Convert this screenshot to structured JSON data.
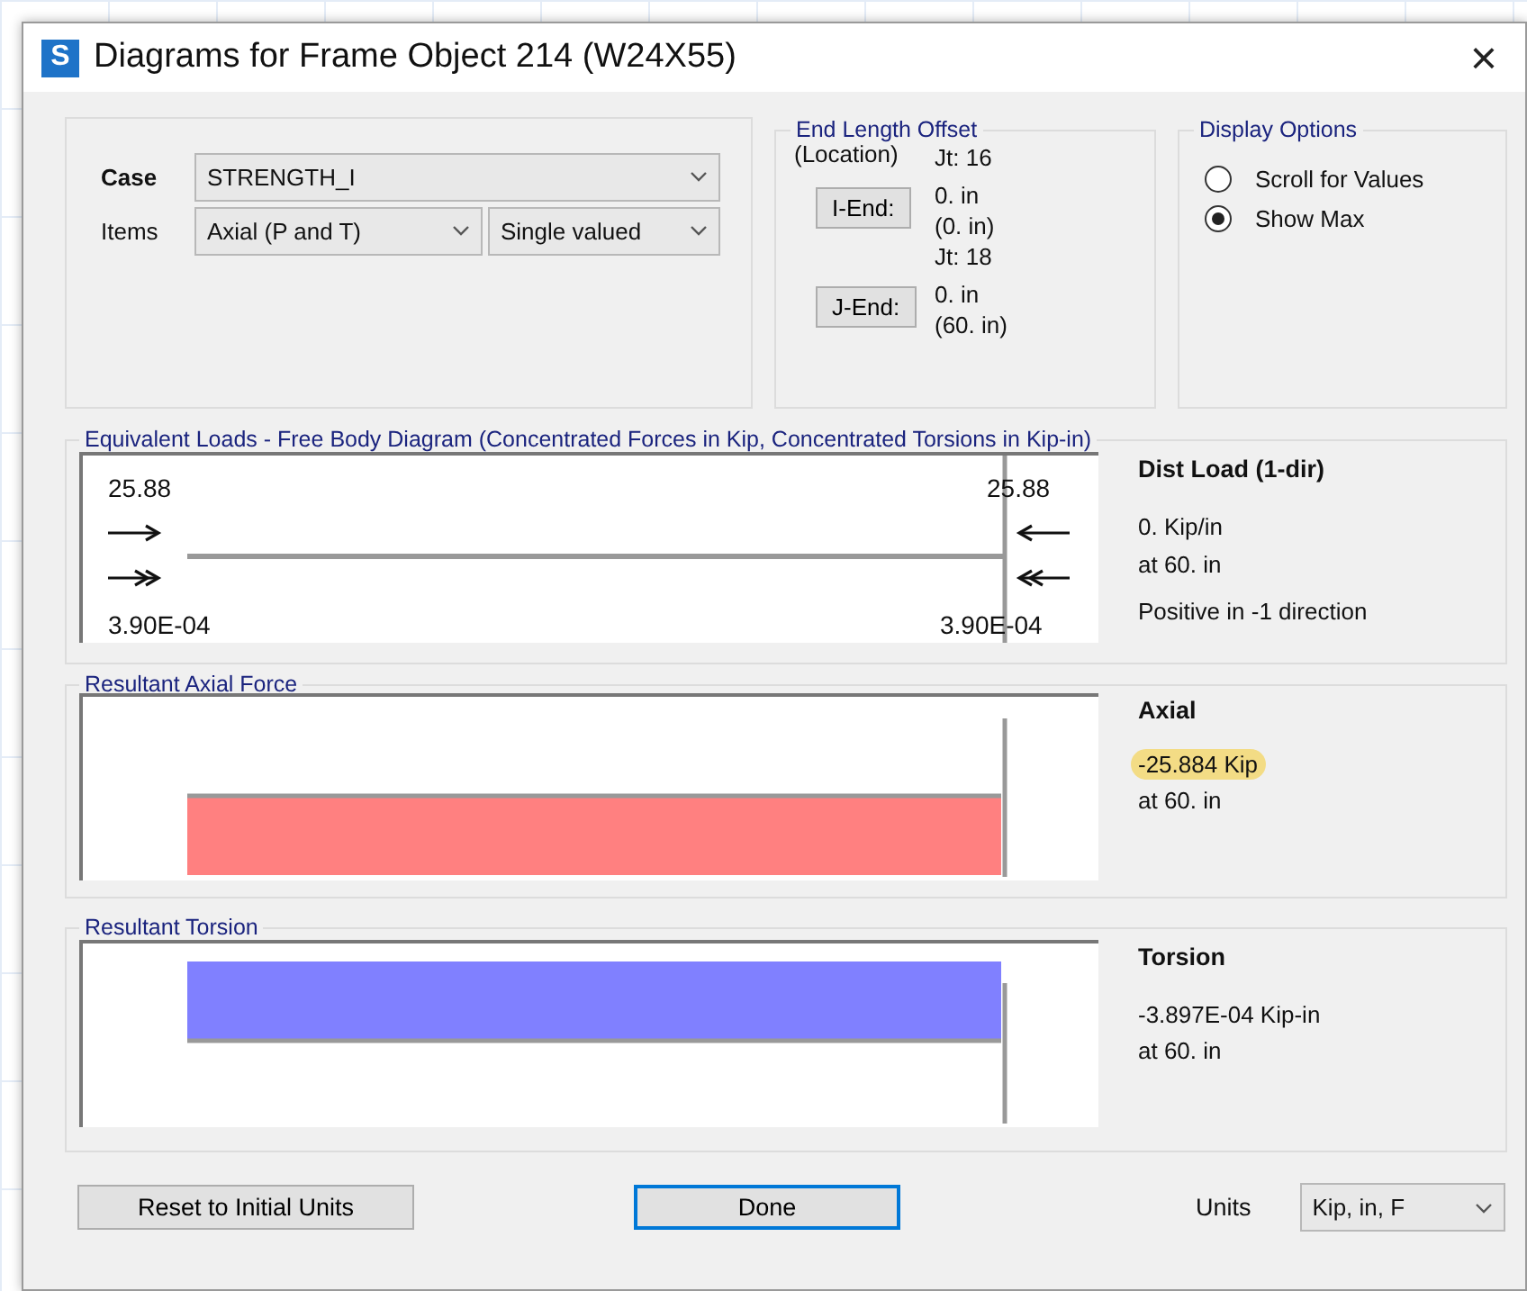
{
  "window": {
    "icon_letter": "S",
    "title": "Diagrams for Frame Object 214  (W24X55)",
    "close": "×"
  },
  "case": {
    "label": "Case",
    "value": "STRENGTH_I"
  },
  "items": {
    "label": "Items",
    "value": "Axial (P and T)",
    "mode": "Single valued"
  },
  "end_length_offset": {
    "title": "End Length Offset",
    "subtitle": "(Location)",
    "ends": [
      {
        "button": "I-End:",
        "joint": "Jt:  16",
        "offset": "0. in",
        "location": "(0. in)"
      },
      {
        "button": "J-End:",
        "joint": "Jt:  18",
        "offset": "0. in",
        "location": "(60. in)"
      }
    ]
  },
  "display_options": {
    "title": "Display Options",
    "options": [
      {
        "label": "Scroll for Values",
        "selected": false
      },
      {
        "label": "Show Max",
        "selected": true
      }
    ]
  },
  "free_body": {
    "title": "Equivalent Loads - Free Body Diagram  (Concentrated Forces in Kip, Concentrated Torsions in Kip-in)",
    "left_force": "25.88",
    "right_force": "25.88",
    "left_torsion": "3.90E-04",
    "right_torsion": "3.90E-04",
    "heading": "Dist Load (1-dir)",
    "lines": [
      "0. Kip/in",
      "at 60. in"
    ],
    "note": "Positive in -1 direction"
  },
  "results": [
    {
      "kind": "axial",
      "title": "Resultant Axial Force",
      "heading": "Axial",
      "value": "-25.884 Kip",
      "highlighted": true,
      "location": "at 60. in",
      "color": "#ff8080"
    },
    {
      "kind": "torsion",
      "title": "Resultant Torsion",
      "heading": "Torsion",
      "value": "-3.897E-04 Kip-in",
      "highlighted": false,
      "location": "at 60. in",
      "color": "#8080ff"
    }
  ],
  "footer": {
    "reset_button": "Reset to Initial Units",
    "done_button": "Done",
    "units_label": "Units",
    "units_value": "Kip, in, F"
  }
}
